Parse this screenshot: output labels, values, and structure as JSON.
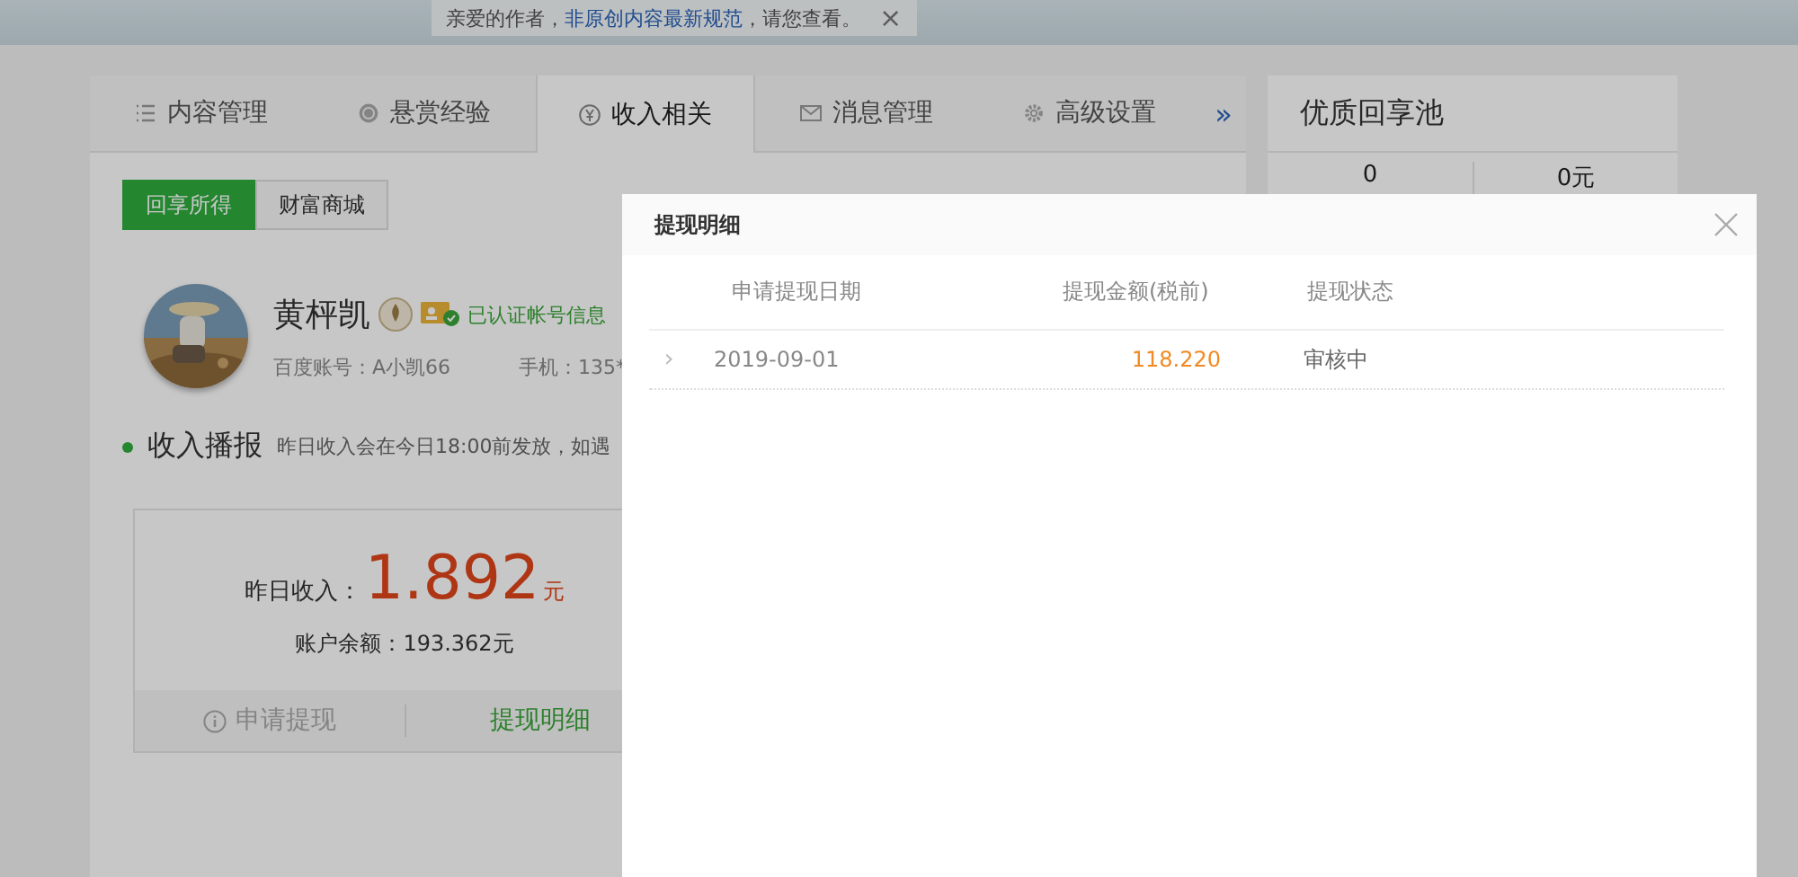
{
  "notice": {
    "before": "亲爱的作者，",
    "link": "非原创内容最新规范",
    "after": "，请您查看。",
    "close": "×"
  },
  "tabs": [
    {
      "label": "内容管理",
      "selected": false
    },
    {
      "label": "悬赏经验",
      "selected": false
    },
    {
      "label": "收入相关",
      "selected": true
    },
    {
      "label": "消息管理",
      "selected": false
    },
    {
      "label": "高级设置",
      "selected": false
    }
  ],
  "more": "»",
  "subtabs": [
    {
      "label": "回享所得",
      "selected": true
    },
    {
      "label": "财富商城",
      "selected": false
    }
  ],
  "profile": {
    "name": "黄枰凯",
    "verified": "已认证帐号信息",
    "account": "百度账号：A小凯66",
    "phone": "手机：135*"
  },
  "broadcast": {
    "title": "收入播报",
    "note": "昨日收入会在今日18:00前发放，如遇"
  },
  "income": {
    "label": "昨日收入：",
    "value": "1.892",
    "unit": "元",
    "balance": "账户余额：193.362元",
    "actions": [
      {
        "label": "申请提现",
        "disabled": true
      },
      {
        "label": "提现明细",
        "disabled": false
      }
    ]
  },
  "pool": {
    "title": "优质回享池",
    "stats": [
      "0",
      "0元"
    ]
  },
  "modal": {
    "title": "提现明细",
    "columns": [
      "申请提现日期",
      "提现金额(税前)",
      "提现状态"
    ],
    "rows": [
      {
        "expander": "›",
        "date": "2019-09-01",
        "amount": "118.220",
        "status": "审核中"
      }
    ]
  }
}
